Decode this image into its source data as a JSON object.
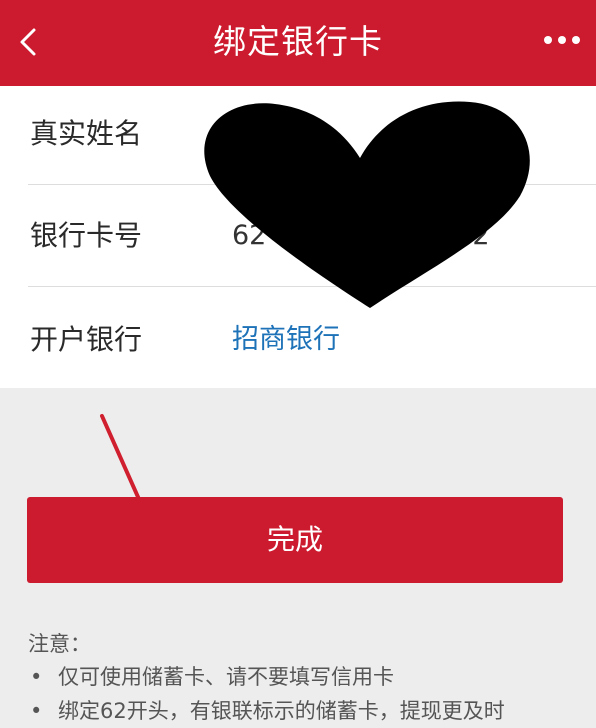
{
  "header": {
    "title": "绑定银行卡",
    "back_icon": "chevron-left-icon",
    "more_icon": "more-dots-icon"
  },
  "form": {
    "rows": [
      {
        "label": "真实姓名",
        "value": ""
      },
      {
        "label": "银行卡号",
        "value": "62                    032"
      },
      {
        "label": "开户银行",
        "value": "招商银行"
      }
    ]
  },
  "done_label": "完成",
  "notes": {
    "title": "注意：",
    "items": [
      "仅可使用储蓄卡、请不要填写信用卡",
      "绑定62开头，有银联标示的储蓄卡，提现更及时"
    ]
  },
  "colors": {
    "brand_red": "#cc1a2e",
    "link_blue": "#1e73b8",
    "background": "#ededed"
  }
}
